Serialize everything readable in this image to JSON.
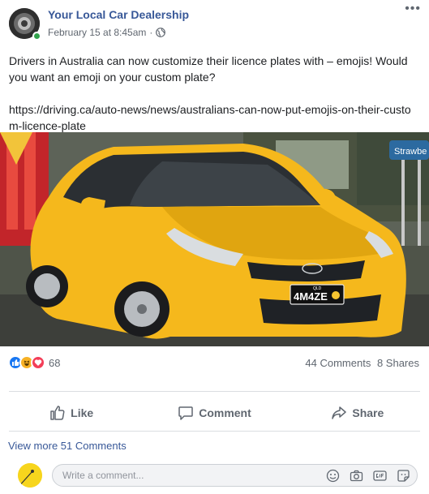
{
  "post": {
    "page_name": "Your Local Car Dealership",
    "timestamp": "February 15 at 8:45am",
    "separator": "·",
    "text": "Drivers in Australia can now customize their licence plates with – emojis! Would you want an emoji on your custom plate?",
    "link": "https://driving.ca/auto-news/news/australians-can-now-put-emojis-on-their-custom-licence-plate",
    "more_icon": "more-horizontal-icon",
    "audience_icon": "globe-icon"
  },
  "photo": {
    "plate_text": "4M4ZE",
    "plate_small": "QLD",
    "sign_text": "Strawbe",
    "car_color": "#f5b81c"
  },
  "stats": {
    "reactions": [
      "like-icon",
      "haha-icon",
      "love-icon"
    ],
    "reaction_count": "68",
    "comments": "44 Comments",
    "shares": "8 Shares"
  },
  "actions": {
    "like": "Like",
    "comment": "Comment",
    "share": "Share"
  },
  "comments": {
    "view_more": "View more 51 Comments",
    "placeholder": "Write a comment..."
  },
  "colors": {
    "link_blue": "#385898",
    "like_blue": "#1877f2",
    "love_red": "#f33e58",
    "haha_yellow": "#f7b125",
    "online_green": "#31a24c"
  }
}
